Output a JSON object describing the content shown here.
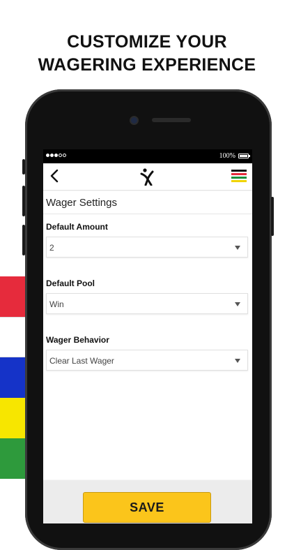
{
  "headline": {
    "line1": "CUSTOMIZE YOUR",
    "line2": "WAGERING EXPERIENCE"
  },
  "decor": {
    "bar_colors": [
      "#e62b3c",
      "#ffffff",
      "#1533c8",
      "#f7e600",
      "#2e9a3c"
    ]
  },
  "statusbar": {
    "signal_dots": 5,
    "signal_filled": 3,
    "battery": "100%"
  },
  "navbar": {
    "back_icon": "chevron-left-icon",
    "logo_icon": "x-figure-logo-icon",
    "menu_icon": "color-stripes-menu-icon",
    "menu_colors": [
      "#111111",
      "#e62b3c",
      "#1a8f3c",
      "#f1d400"
    ]
  },
  "page": {
    "title": "Wager Settings"
  },
  "fields": [
    {
      "label": "Default Amount",
      "value": "2"
    },
    {
      "label": "Default Pool",
      "value": "Win"
    },
    {
      "label": "Wager Behavior",
      "value": "Clear Last Wager"
    }
  ],
  "footer": {
    "save_label": "SAVE",
    "save_color": "#fbc51b"
  }
}
